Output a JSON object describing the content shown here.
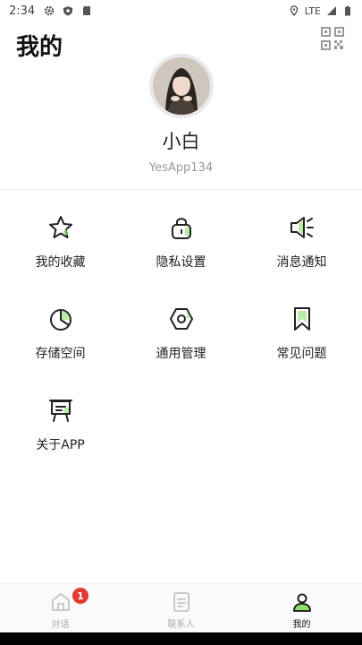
{
  "status_bar": {
    "time": "2:34",
    "network": "LTE"
  },
  "header": {
    "title": "我的"
  },
  "profile": {
    "name": "小白",
    "id": "YesApp134"
  },
  "menu": [
    {
      "label": "我的收藏",
      "icon": "star-icon"
    },
    {
      "label": "隐私设置",
      "icon": "lock-icon"
    },
    {
      "label": "消息通知",
      "icon": "speaker-icon"
    },
    {
      "label": "存储空间",
      "icon": "pie-chart-icon"
    },
    {
      "label": "通用管理",
      "icon": "settings-hex-icon"
    },
    {
      "label": "常见问题",
      "icon": "bookmark-icon"
    },
    {
      "label": "关于APP",
      "icon": "easel-icon"
    }
  ],
  "tabs": [
    {
      "label": "对话",
      "icon": "home-icon",
      "badge": "1"
    },
    {
      "label": "联系人",
      "icon": "contacts-icon"
    },
    {
      "label": "我的",
      "icon": "person-icon",
      "active": true
    }
  ],
  "colors": {
    "accent": "#8BDF6E",
    "badge": "#E53935"
  }
}
